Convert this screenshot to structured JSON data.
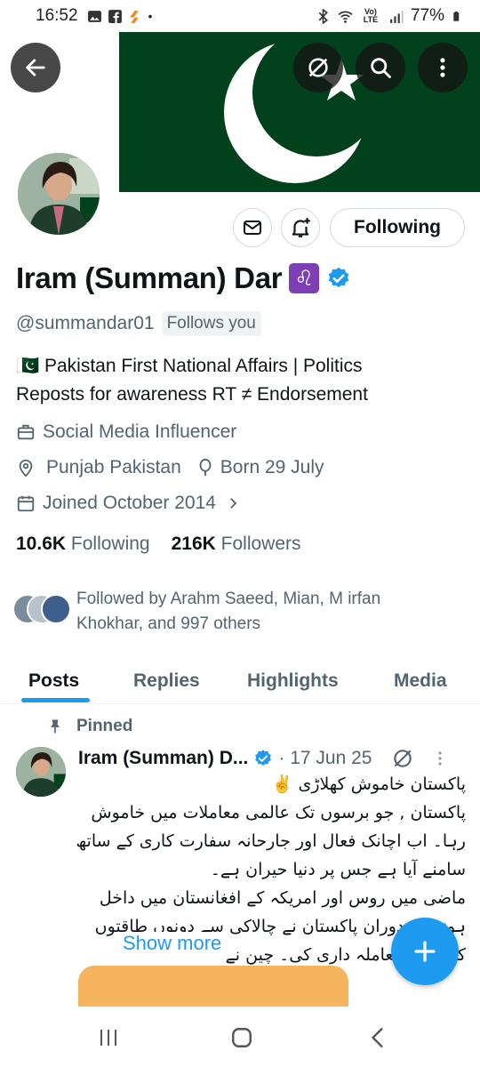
{
  "status_bar": {
    "time": "16:52",
    "battery": "77%",
    "network": "Vo) LTE"
  },
  "profile": {
    "name": "Iram (Summan) Dar",
    "zodiac_emoji": "♌",
    "handle": "@summandar01",
    "follows_you": "Follows you",
    "bio_line1": "🇵🇰 Pakistan First National Affairs | Politics",
    "bio_line2": "Reposts for awareness RT ≠ Endorsement",
    "category": "Social Media Influencer",
    "location": "Punjab Pakistan",
    "birthday": "Born 29 July",
    "joined": "Joined October 2014",
    "following_count": "10.6K",
    "following_label": "Following",
    "followers_count": "216K",
    "followers_label": "Followers",
    "followed_by_line1": "Followed by Arahm Saeed, Mian, M irfan",
    "followed_by_line2": "Khokhar, and 997 others",
    "following_button": "Following"
  },
  "tabs": [
    {
      "label": "Posts",
      "active": true
    },
    {
      "label": "Replies",
      "active": false
    },
    {
      "label": "Highlights",
      "active": false
    },
    {
      "label": "Media",
      "active": false
    }
  ],
  "pinned_post": {
    "pinned_label": "Pinned",
    "author": "Iram (Summan) D...",
    "date": "· 17 Jun 25",
    "line1": "پاکستان خاموش کھلاڑی ✌️",
    "line2": "پاکستان , جو برسوں تک عالمی معاملات میں خاموش",
    "line3": "رہا۔ اب اچانک فعال اور جارحانہ سفارت کاری کے ساتھ",
    "line4": "سامنے آیا ہے جس پر دنیا حیران ہے۔",
    "line5": "ماضی میں روس اور امریکہ کے افغانستان میں داخل",
    "line6": "ہونے کے دوران پاکستان نے چالاکی سے دونوں طاقتوں",
    "line7": "کے ساتھ معاملہ داری کی۔ چین نے",
    "show_more": "Show more"
  },
  "colors": {
    "accent": "#1d9bf0",
    "flag_green": "#01411c",
    "muted": "#536471",
    "text": "#0f1419"
  }
}
